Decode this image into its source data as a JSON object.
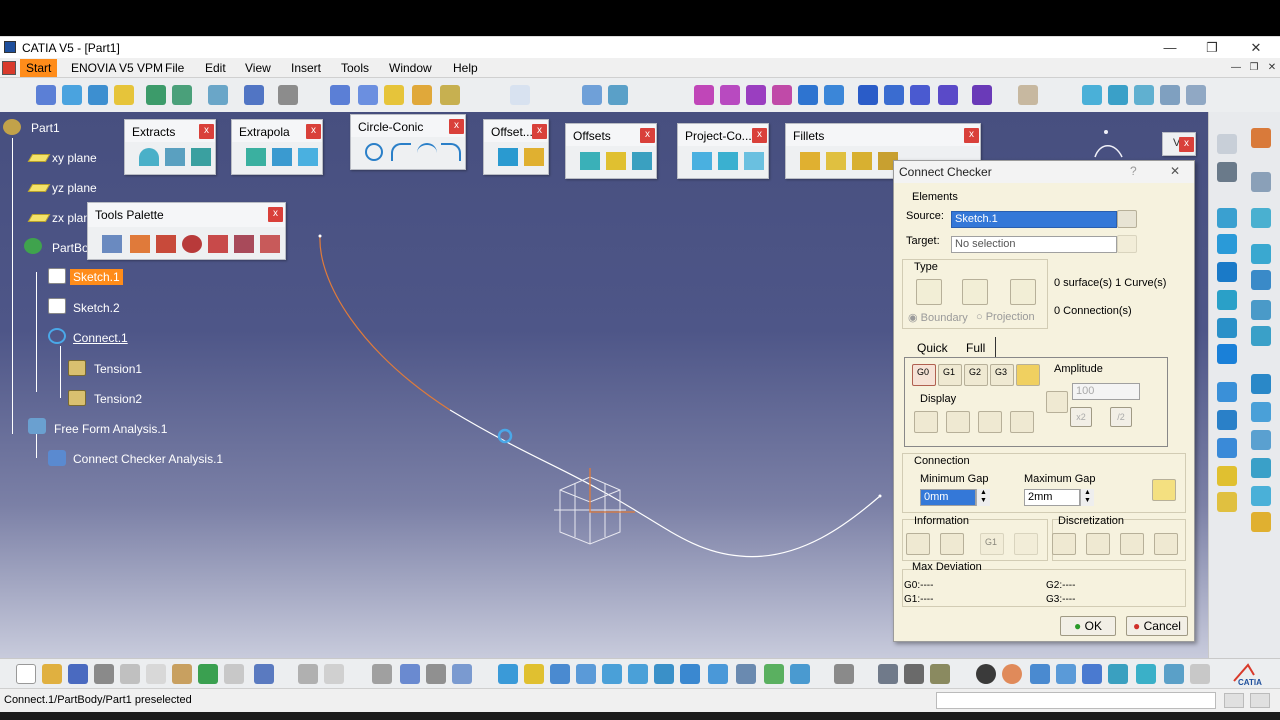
{
  "window": {
    "title": "CATIA V5 - [Part1]",
    "minimize": "—",
    "restore": "❐",
    "close": "✕"
  },
  "menu": [
    "Start",
    "ENOVIA V5 VPM",
    "File",
    "Edit",
    "View",
    "Insert",
    "Tools",
    "Window",
    "Help"
  ],
  "tree": {
    "root": "Part1",
    "items": {
      "xy": "xy plane",
      "yz": "yz plane",
      "zx": "zx plane",
      "partbody": "PartBody",
      "sketch1": "Sketch.1",
      "sketch2": "Sketch.2",
      "connect1": "Connect.1",
      "tension1": "Tension1",
      "tension2": "Tension2",
      "ffa": "Free Form Analysis.1",
      "cca": "Connect Checker Analysis.1"
    }
  },
  "floating_toolbars": {
    "extracts": "Extracts",
    "extrapola": "Extrapola",
    "circle": "Circle-Conic",
    "offset": "Offset...",
    "offsets": "Offsets",
    "project": "Project-Co...",
    "fillets": "Fillets",
    "tools_palette": "Tools Palette",
    "close": "x"
  },
  "dialog": {
    "title": "Connect Checker",
    "help": "?",
    "close": "✕",
    "elements_label": "Elements",
    "source_label": "Source:",
    "source_value": "Sketch.1",
    "target_label": "Target:",
    "target_value": "No selection",
    "type_label": "Type",
    "counts_line1": "0 surface(s)  1 Curve(s)",
    "counts_line2": "0 Connection(s)",
    "boundary": "Boundary",
    "projection": "Projection",
    "tab_quick": "Quick",
    "tab_full": "Full",
    "amplitude_label": "Amplitude",
    "amplitude_value": "100",
    "display_label": "Display",
    "g_buttons": [
      "G0",
      "G1",
      "G2",
      "G3"
    ],
    "x2": "x2",
    "div2": "/2",
    "connection_label": "Connection",
    "min_gap_label": "Minimum Gap",
    "min_gap_value": "0mm",
    "max_gap_label": "Maximum Gap",
    "max_gap_value": "2mm",
    "information_label": "Information",
    "g1_btn": "G1",
    "discretization_label": "Discretization",
    "max_dev_label": "Max Deviation",
    "dev": {
      "g0": "G0:----",
      "g1": "G1:----",
      "g2": "G2:----",
      "g3": "G3:----"
    },
    "ok": "OK",
    "cancel": "Cancel"
  },
  "status_text": "Connect.1/PartBody/Part1 preselected",
  "brand": "CATIA",
  "colors": {
    "highlight": "#ff8c1a",
    "selection": "#3478d8",
    "dialog_bg": "#f6f2de"
  }
}
